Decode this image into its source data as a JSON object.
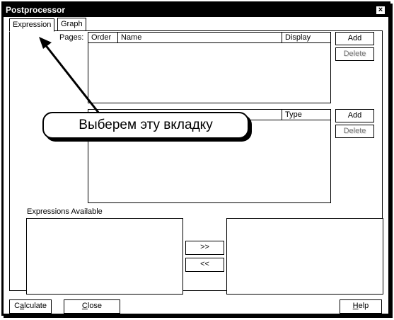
{
  "window": {
    "title": "Postprocessor",
    "close_glyph": "×"
  },
  "tabs": [
    {
      "label": "Expression",
      "active": true
    },
    {
      "label": "Graph",
      "active": false
    }
  ],
  "pages": {
    "label": "Pages:",
    "columns": [
      "Order",
      "Name",
      "Display"
    ],
    "add_label": "Add",
    "delete_label": "Delete"
  },
  "curves": {
    "columns": [
      "Type"
    ],
    "add_label": "Add",
    "delete_label": "Delete"
  },
  "expressions": {
    "label": "Expressions Available",
    "move_right_label": ">>",
    "move_left_label": "<<"
  },
  "footer": {
    "calculate_pre": "C",
    "calculate_acc": "a",
    "calculate_post": "lculate",
    "close_acc": "C",
    "close_post": "lose",
    "help_acc": "H",
    "help_post": "elp"
  },
  "annotation": {
    "callout_text": "Выберем эту вкладку"
  },
  "colors": {
    "frame": "#000000",
    "background": "#ffffff",
    "disabled_text": "#777777"
  }
}
